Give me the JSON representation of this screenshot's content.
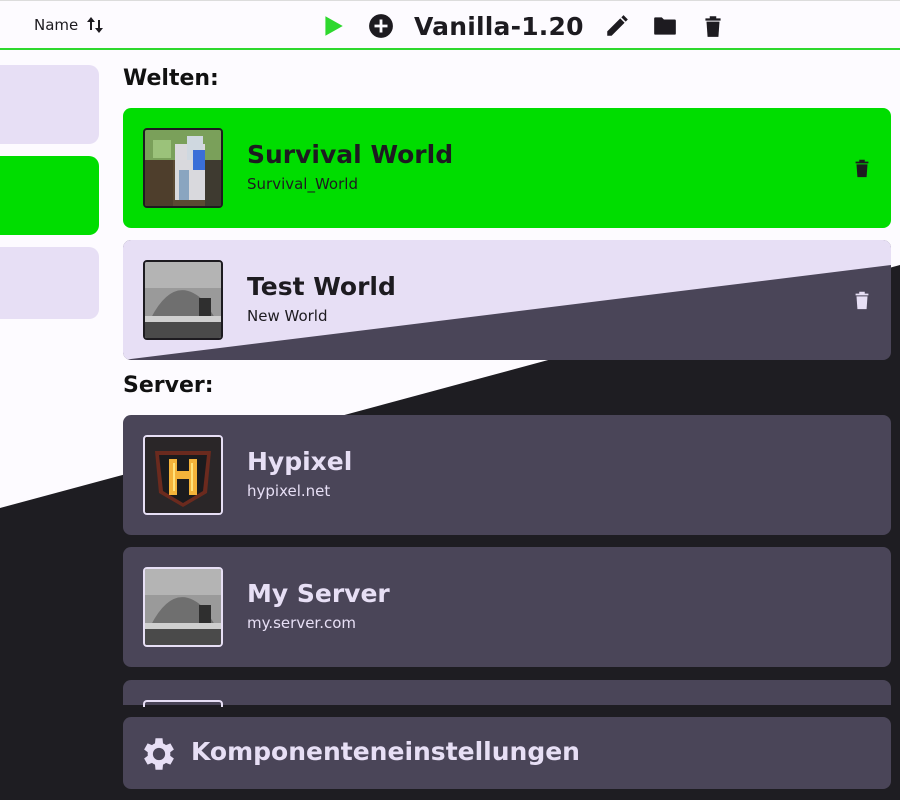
{
  "topbar": {
    "sort_label": "Name",
    "profile_name": "Vanilla-1.20",
    "icons": [
      "sort-icon",
      "play-icon",
      "add-circle-icon",
      "pencil-icon",
      "folder-icon",
      "trash-icon"
    ],
    "accent": "#2ed82e"
  },
  "sidebar": {
    "tabs": [
      {
        "name": "tab-1",
        "active": false
      },
      {
        "name": "tab-2",
        "active": true
      },
      {
        "name": "tab-3",
        "active": false
      }
    ]
  },
  "worlds": {
    "heading": "Welten:",
    "items": [
      {
        "title": "Survival World",
        "subtitle": "Survival_World",
        "selected": true
      },
      {
        "title": "Test World",
        "subtitle": "New World",
        "selected": false
      }
    ]
  },
  "servers": {
    "heading": "Server:",
    "items": [
      {
        "title": "Hypixel",
        "subtitle": "hypixel.net"
      },
      {
        "title": "My Server",
        "subtitle": "my.server.com"
      }
    ]
  },
  "footer": {
    "label": "Komponenteneinstellungen",
    "icon": "gear-icon"
  },
  "colors": {
    "selected": "#00dd00",
    "card_dark": "#4a4558",
    "card_light": "#e7dff5",
    "background_dark": "#1e1d22"
  }
}
